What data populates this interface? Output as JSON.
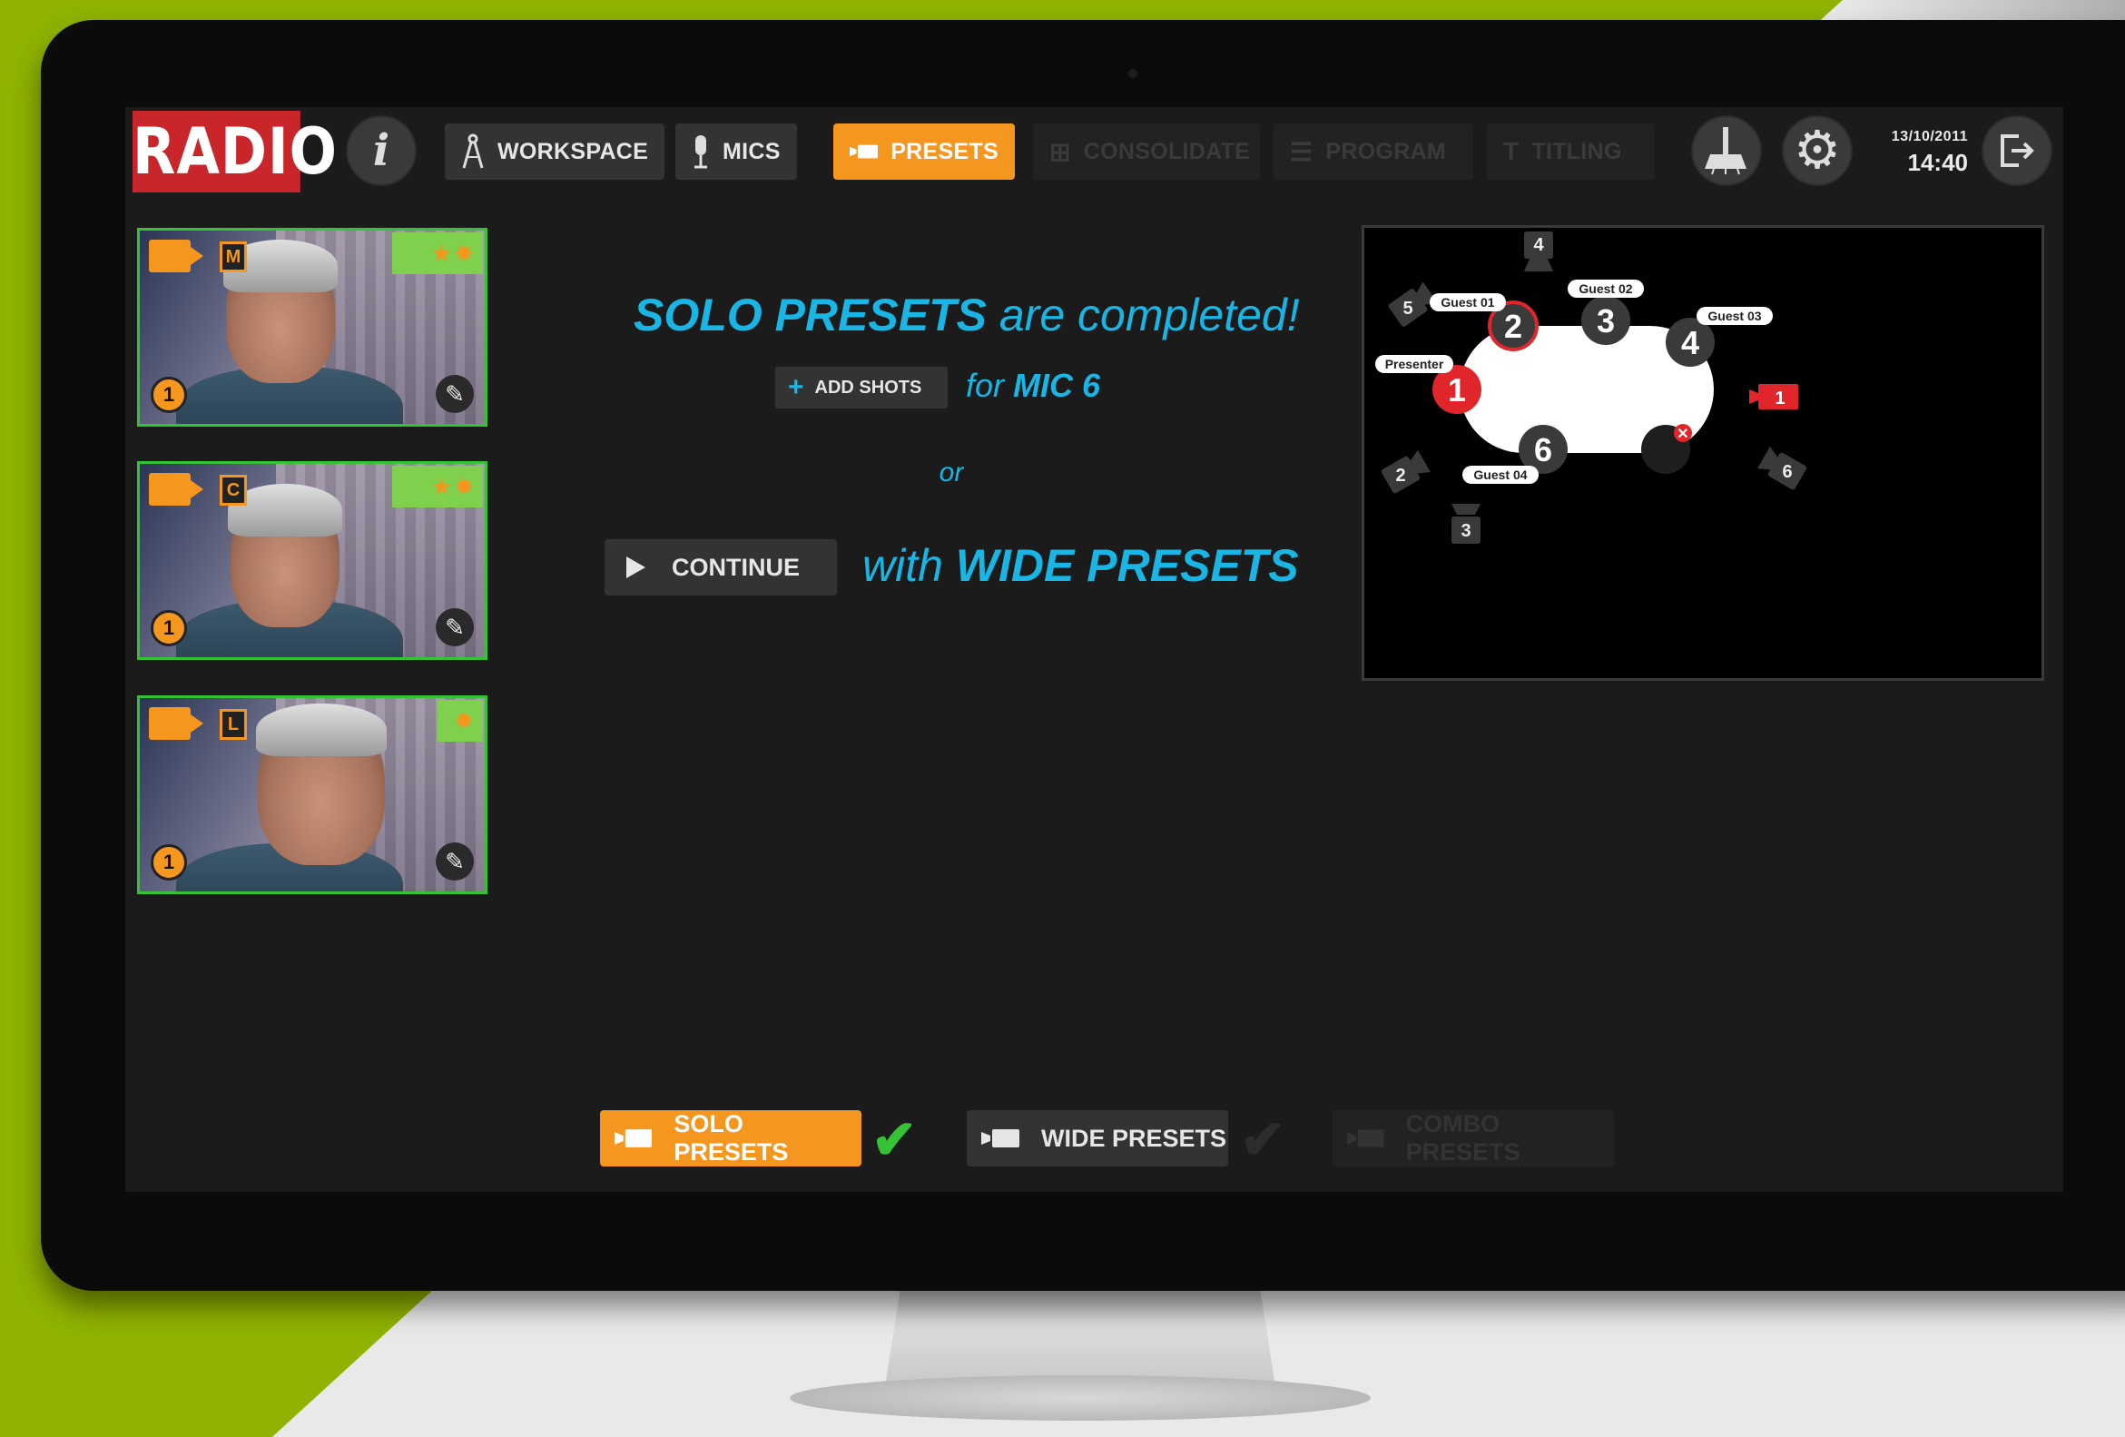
{
  "app": {
    "logo": "RADIO",
    "date": "13/10/2011",
    "time": "14:40"
  },
  "nav": {
    "workspace": "WORKSPACE",
    "mics": "MICS",
    "presets": "PRESETS",
    "consolidate": "CONSOLIDATE",
    "program": "PROGRAM",
    "titling": "TITLING"
  },
  "thumbnails": [
    {
      "size": "M",
      "number": "1"
    },
    {
      "size": "C",
      "number": "1"
    },
    {
      "size": "L",
      "number": "1"
    }
  ],
  "message": {
    "bold": "SOLO PRESETS",
    "rest": " are completed!",
    "add_shots": "ADD SHOTS",
    "for_prefix": "for ",
    "for_mic": "MIC 6",
    "or": "or",
    "continue": "CONTINUE",
    "with_prefix": "with ",
    "with_bold": "WIDE PRESETS"
  },
  "studio_map": {
    "labels": {
      "guest01": "Guest 01",
      "guest02": "Guest 02",
      "guest03": "Guest 03",
      "guest04": "Guest 04",
      "presenter": "Presenter"
    },
    "seats": [
      "1",
      "2",
      "3",
      "4",
      "6"
    ],
    "cameras": [
      "1",
      "2",
      "3",
      "4",
      "5",
      "6"
    ]
  },
  "tabs": {
    "solo": "SOLO PRESETS",
    "wide": "WIDE PRESETS",
    "combo": "COMBO PRESETS"
  },
  "colors": {
    "accent_orange": "#f5961e",
    "accent_blue": "#19b6e5",
    "logo_red": "#c8262a",
    "ok_green": "#35c235"
  }
}
